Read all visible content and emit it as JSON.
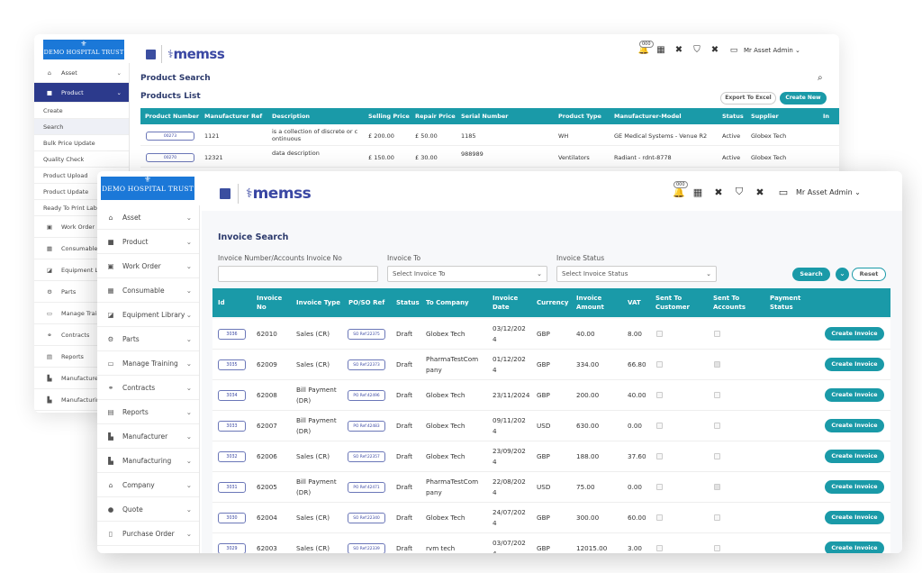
{
  "back_window": {
    "logo": "DEMO HOSPITAL TRUST",
    "brand": "memss",
    "user": "Mr Asset Admin",
    "badge": "000",
    "sidebar": {
      "items": [
        {
          "label": "Asset"
        },
        {
          "label": "Product"
        },
        {
          "label": "Create"
        },
        {
          "label": "Search"
        },
        {
          "label": "Bulk Price Update"
        },
        {
          "label": "Quality Check"
        },
        {
          "label": "Product Upload"
        },
        {
          "label": "Product Update"
        },
        {
          "label": "Ready To Print Lab"
        },
        {
          "label": "Work Order"
        },
        {
          "label": "Consumable"
        },
        {
          "label": "Equipment Libr"
        },
        {
          "label": "Parts"
        },
        {
          "label": "Manage Trainin"
        },
        {
          "label": "Contracts"
        },
        {
          "label": "Reports"
        },
        {
          "label": "Manufacturer"
        },
        {
          "label": "Manufacturing"
        }
      ]
    },
    "page_title": "Product Search",
    "list_title": "Products List",
    "export_label": "Export To Excel",
    "create_new_label": "Create New",
    "columns": [
      "Product Number",
      "Manufacturer Ref",
      "Description",
      "Selling Price",
      "Repair Price",
      "Serial Number",
      "Product Type",
      "Manufacturer-Model",
      "Status",
      "Supplier",
      "In"
    ],
    "rows": [
      {
        "num": "00273",
        "ref": "1121",
        "desc": "is a collection of discrete or c",
        "desc2": "ontinuous",
        "sell": "£ 200.00",
        "repair": "£ 50.00",
        "serial": "1185",
        "type": "WH",
        "model": "GE Medical Systems - Venue R2",
        "status": "Active",
        "supplier": "Globex Tech"
      },
      {
        "num": "00270",
        "ref": "12321",
        "desc": "data description",
        "desc2": "",
        "sell": "£ 150.00",
        "repair": "£ 30.00",
        "serial": "988989",
        "type": "Ventilators",
        "model": "Radiant - rdnt-8778",
        "status": "Active",
        "supplier": "Globex Tech"
      }
    ]
  },
  "front_window": {
    "logo": "DEMO HOSPITAL TRUST",
    "brand": "memss",
    "user": "Mr Asset Admin",
    "badge": "000",
    "sidebar": {
      "items": [
        {
          "label": "Asset",
          "icon": "asset-icon"
        },
        {
          "label": "Product",
          "icon": "product-icon"
        },
        {
          "label": "Work Order",
          "icon": "work-order-icon"
        },
        {
          "label": "Consumable",
          "icon": "consumable-icon"
        },
        {
          "label": "Equipment Library",
          "icon": "equipment-library-icon"
        },
        {
          "label": "Parts",
          "icon": "parts-icon"
        },
        {
          "label": "Manage Training",
          "icon": "training-icon"
        },
        {
          "label": "Contracts",
          "icon": "contracts-icon"
        },
        {
          "label": "Reports",
          "icon": "reports-icon"
        },
        {
          "label": "Manufacturer",
          "icon": "manufacturer-icon"
        },
        {
          "label": "Manufacturing",
          "icon": "manufacturing-icon"
        },
        {
          "label": "Company",
          "icon": "company-icon"
        },
        {
          "label": "Quote",
          "icon": "quote-icon"
        },
        {
          "label": "Purchase Order",
          "icon": "purchase-order-icon"
        }
      ]
    },
    "page_title": "Invoice Search",
    "filters": {
      "invoice_number_label": "Invoice Number/Accounts Invoice No",
      "invoice_number_value": "",
      "invoice_to_label": "Invoice To",
      "invoice_to_placeholder": "Select Invoice To",
      "invoice_status_label": "Invoice Status",
      "invoice_status_placeholder": "Select Invoice Status",
      "search_label": "Search",
      "reset_label": "Reset"
    },
    "columns": [
      "Id",
      "Invoice No",
      "Invoice Type",
      "PO/SO Ref",
      "Status",
      "To Company",
      "Invoice Date",
      "Currency",
      "Invoice Amount",
      "VAT",
      "Sent To Customer",
      "Sent To Accounts",
      "Payment Status"
    ],
    "create_invoice_label": "Create Invoice",
    "rows": [
      {
        "id": "3036",
        "no": "62010",
        "type1": "Sales (CR)",
        "type2": "",
        "ref": "SO Ref:22375",
        "status": "Draft",
        "company1": "Globex Tech",
        "company2": "",
        "date1": "03/12/202",
        "date2": "4",
        "currency": "GBP",
        "amount": "40.00",
        "vat": "8.00",
        "sent_customer": false,
        "sent_accounts": false
      },
      {
        "id": "3035",
        "no": "62009",
        "type1": "Sales (CR)",
        "type2": "",
        "ref": "SO Ref:22373",
        "status": "Draft",
        "company1": "PharmaTestCom",
        "company2": "pany",
        "date1": "01/12/202",
        "date2": "4",
        "currency": "GBP",
        "amount": "334.00",
        "vat": "66.80",
        "sent_customer": false,
        "sent_accounts": true
      },
      {
        "id": "3034",
        "no": "62008",
        "type1": "Bill Payment",
        "type2": "(DR)",
        "ref": "PO Ref:42496",
        "status": "Draft",
        "company1": "Globex Tech",
        "company2": "",
        "date1": "23/11/2024",
        "date2": "",
        "currency": "GBP",
        "amount": "200.00",
        "vat": "40.00",
        "sent_customer": false,
        "sent_accounts": false
      },
      {
        "id": "3033",
        "no": "62007",
        "type1": "Bill Payment",
        "type2": "(DR)",
        "ref": "PO Ref:42483",
        "status": "Draft",
        "company1": "Globex Tech",
        "company2": "",
        "date1": "09/11/202",
        "date2": "4",
        "currency": "USD",
        "amount": "630.00",
        "vat": "0.00",
        "sent_customer": false,
        "sent_accounts": false
      },
      {
        "id": "3032",
        "no": "62006",
        "type1": "Sales (CR)",
        "type2": "",
        "ref": "SO Ref:22357",
        "status": "Draft",
        "company1": "Globex Tech",
        "company2": "",
        "date1": "23/09/202",
        "date2": "4",
        "currency": "GBP",
        "amount": "188.00",
        "vat": "37.60",
        "sent_customer": false,
        "sent_accounts": false
      },
      {
        "id": "3031",
        "no": "62005",
        "type1": "Bill Payment",
        "type2": "(DR)",
        "ref": "PO Ref:42471",
        "status": "Draft",
        "company1": "PharmaTestCom",
        "company2": "pany",
        "date1": "22/08/202",
        "date2": "4",
        "currency": "USD",
        "amount": "75.00",
        "vat": "0.00",
        "sent_customer": false,
        "sent_accounts": true
      },
      {
        "id": "3030",
        "no": "62004",
        "type1": "Sales (CR)",
        "type2": "",
        "ref": "SO Ref:22340",
        "status": "Draft",
        "company1": "Globex Tech",
        "company2": "",
        "date1": "24/07/202",
        "date2": "4",
        "currency": "GBP",
        "amount": "300.00",
        "vat": "60.00",
        "sent_customer": false,
        "sent_accounts": false
      },
      {
        "id": "3029",
        "no": "62003",
        "type1": "Sales (CR)",
        "type2": "",
        "ref": "SO Ref:22339",
        "status": "Draft",
        "company1": "rvm tech",
        "company2": "",
        "date1": "03/07/202",
        "date2": "4",
        "currency": "GBP",
        "amount": "12015.00",
        "vat": "3.00",
        "sent_customer": false,
        "sent_accounts": false
      }
    ]
  }
}
